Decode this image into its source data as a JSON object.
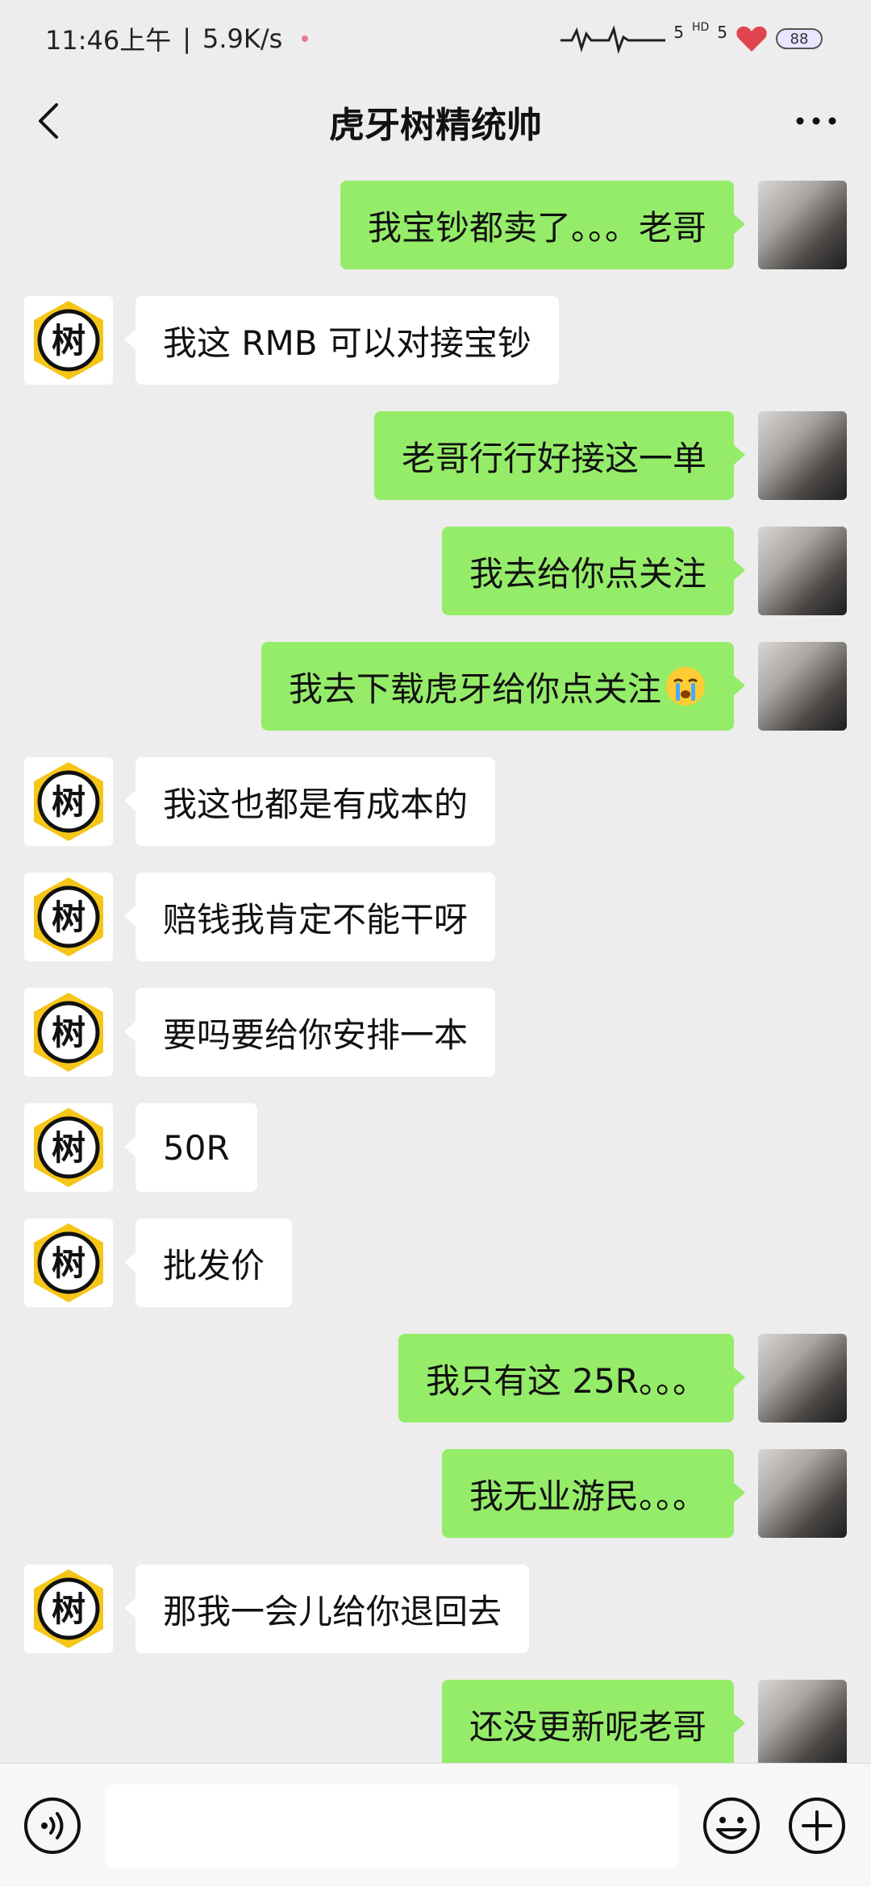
{
  "status_bar": {
    "time": "11:46上午",
    "separator": "|",
    "net_speed": "5.9K/s",
    "signal_1": "5",
    "hd": "HD",
    "signal_2": "5",
    "battery": "88"
  },
  "header": {
    "title": "虎牙树精统帅",
    "back_icon": "chevron-left-icon",
    "more_icon": "more-dots-icon"
  },
  "contact_avatar_char": "树",
  "messages": [
    {
      "side": "right",
      "text": "我宝钞都卖了。。。老哥"
    },
    {
      "side": "left",
      "text": "我这 RMB 可以对接宝钞"
    },
    {
      "side": "right",
      "text": "老哥行行好接这一单"
    },
    {
      "side": "right",
      "text": "我去给你点关注"
    },
    {
      "side": "right",
      "text": "我去下载虎牙给你点关注",
      "emoji": "crying-face-emoji"
    },
    {
      "side": "left",
      "text": "我这也都是有成本的"
    },
    {
      "side": "left",
      "text": "赔钱我肯定不能干呀"
    },
    {
      "side": "left",
      "text": "要吗要给你安排一本"
    },
    {
      "side": "left",
      "text": "50R"
    },
    {
      "side": "left",
      "text": "批发价"
    },
    {
      "side": "right",
      "text": "我只有这 25R。。。"
    },
    {
      "side": "right",
      "text": "我无业游民。。。"
    },
    {
      "side": "left",
      "text": "那我一会儿给你退回去"
    },
    {
      "side": "right",
      "text": "还没更新呢老哥"
    }
  ],
  "input_bar": {
    "value": "",
    "voice_icon": "voice-icon",
    "emoji_icon": "emoji-icon",
    "plus_icon": "plus-icon"
  },
  "colors": {
    "background": "#ededed",
    "outgoing_bubble": "#95ec69",
    "incoming_bubble": "#ffffff",
    "avatar_badge": "#f5c518"
  }
}
